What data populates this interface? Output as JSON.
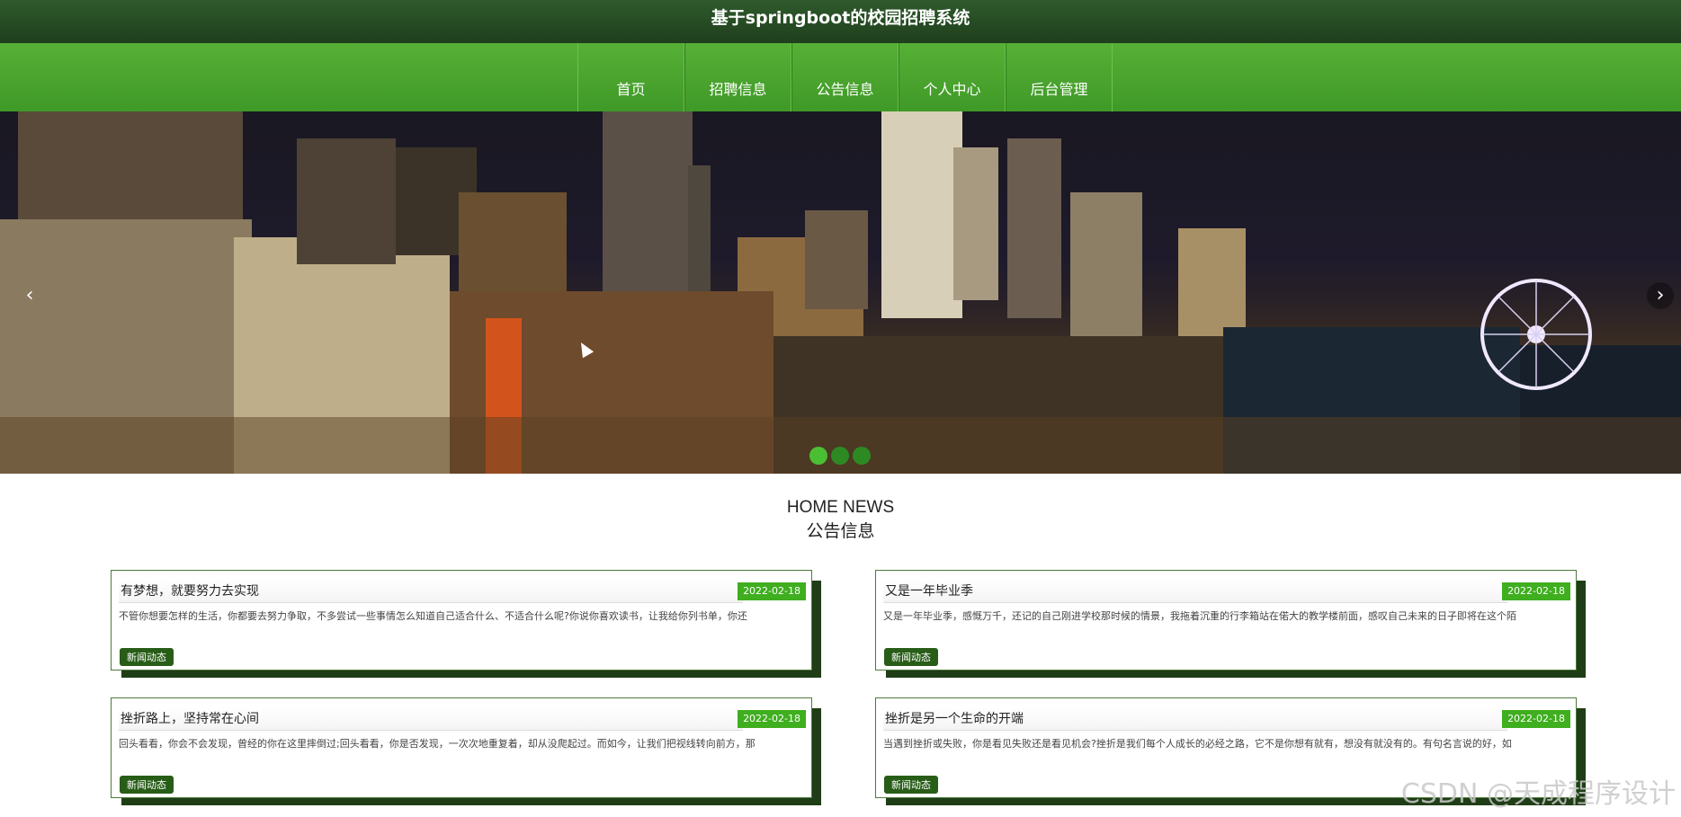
{
  "header": {
    "title": "基于springboot的校园招聘系统"
  },
  "nav": {
    "items": [
      "首页",
      "招聘信息",
      "公告信息",
      "个人中心",
      "后台管理"
    ]
  },
  "banner": {
    "prev_icon": "chevron-left-icon",
    "next_icon": "chevron-right-icon",
    "prev_glyph": "‹",
    "next_glyph": "›",
    "slide_count": 3,
    "active_slide": 1
  },
  "section": {
    "title_en": "HOME NEWS",
    "title_cn": "公告信息"
  },
  "news": [
    {
      "title": "有梦想，就要努力去实现",
      "date": "2022-02-18",
      "excerpt": "不管你想要怎样的生活，你都要去努力争取，不多尝试一些事情怎么知道自己适合什么、不适合什么呢?你说你喜欢读书，让我给你列书单，你还",
      "tag": "新闻动态"
    },
    {
      "title": "又是一年毕业季",
      "date": "2022-02-18",
      "excerpt": "又是一年毕业季，感慨万千，还记的自己刚进学校那时候的情景，我拖着沉重的行李箱站在偌大的教学楼前面，感叹自己未来的日子即将在这个陌",
      "tag": "新闻动态"
    },
    {
      "title": "挫折路上，坚持常在心间",
      "date": "2022-02-18",
      "excerpt": "回头看看，你会不会发现，曾经的你在这里摔倒过;回头看看，你是否发现，一次次地重复着，却从没爬起过。而如今，让我们把视线转向前方，那",
      "tag": "新闻动态"
    },
    {
      "title": "挫折是另一个生命的开端",
      "date": "2022-02-18",
      "excerpt": "当遇到挫折或失败，你是看见失败还是看见机会?挫折是我们每个人成长的必经之路，它不是你想有就有，想没有就没有的。有句名言说的好，如",
      "tag": "新闻动态"
    }
  ],
  "watermark": "CSDN @天成程序设计"
}
